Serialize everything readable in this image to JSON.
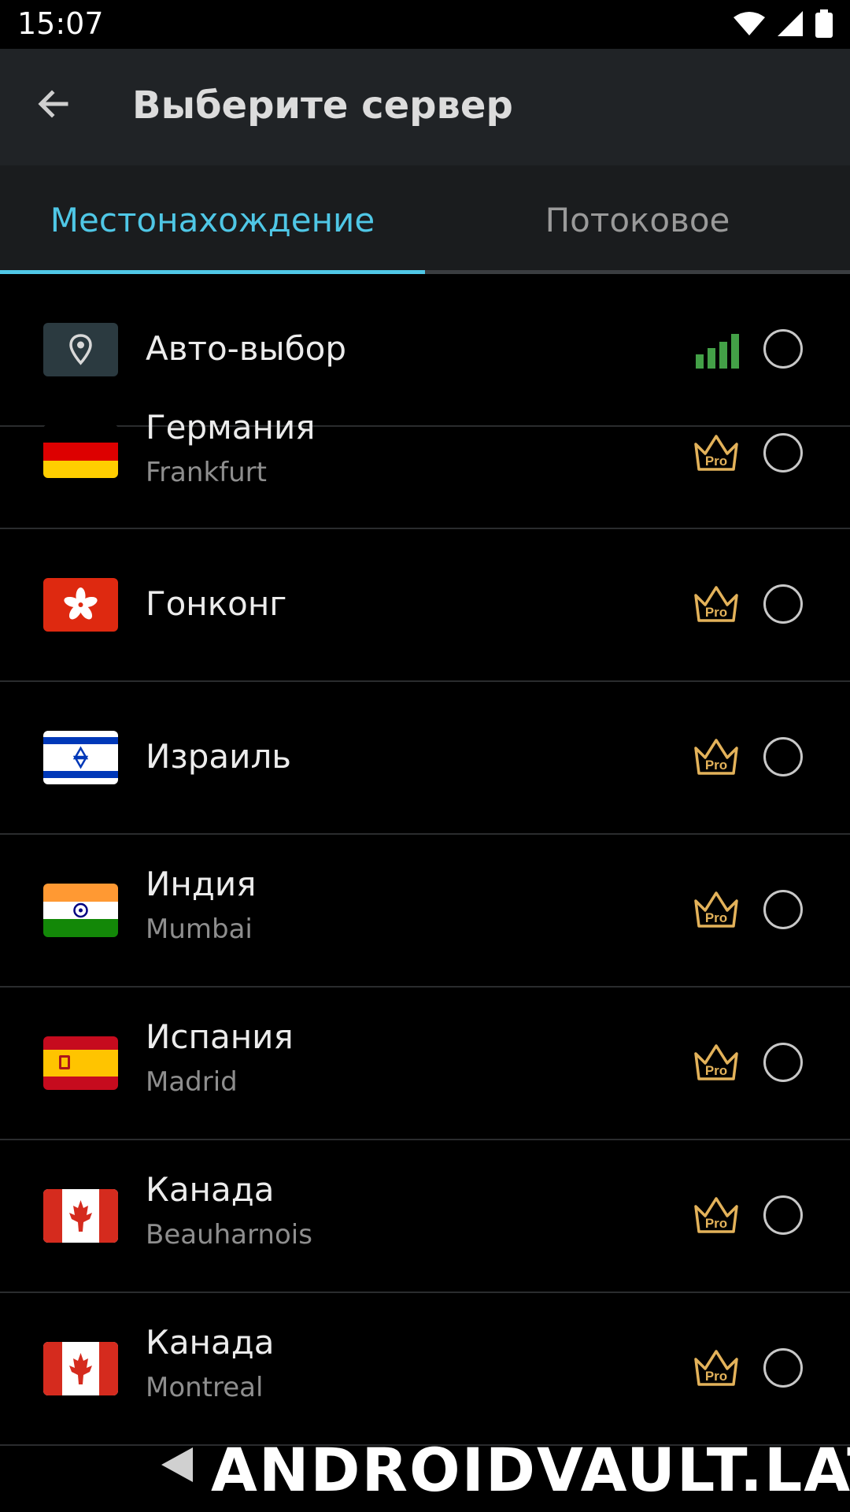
{
  "status_bar": {
    "time": "15:07"
  },
  "app_bar": {
    "title": "Выберите сервер"
  },
  "tabs": [
    {
      "label": "Местонахождение",
      "active": true
    },
    {
      "label": "Потоковое",
      "active": false
    }
  ],
  "colors": {
    "accent": "#4fc7e6",
    "pro_gold": "#e3b25a",
    "signal_green": "#43a047",
    "app_bar": "#202326"
  },
  "servers": [
    {
      "name": "Авто-выбор",
      "city": "",
      "icon": "location-pin-icon",
      "badge": "signal-strength-icon",
      "selected": false
    },
    {
      "name": "Германия",
      "city": "Frankfurt",
      "icon": "germany-flag-icon",
      "badge": "pro-crown-icon",
      "badge_text": "Pro",
      "selected": false
    },
    {
      "name": "Гонконг",
      "city": "",
      "icon": "hong-kong-flag-icon",
      "badge": "pro-crown-icon",
      "badge_text": "Pro",
      "selected": false
    },
    {
      "name": "Израиль",
      "city": "",
      "icon": "israel-flag-icon",
      "badge": "pro-crown-icon",
      "badge_text": "Pro",
      "selected": false
    },
    {
      "name": "Индия",
      "city": "Mumbai",
      "icon": "india-flag-icon",
      "badge": "pro-crown-icon",
      "badge_text": "Pro",
      "selected": false
    },
    {
      "name": "Испания",
      "city": "Madrid",
      "icon": "spain-flag-icon",
      "badge": "pro-crown-icon",
      "badge_text": "Pro",
      "selected": false
    },
    {
      "name": "Канада",
      "city": "Beauharnois",
      "icon": "canada-flag-icon",
      "badge": "pro-crown-icon",
      "badge_text": "Pro",
      "selected": false
    },
    {
      "name": "Канада",
      "city": "Montreal",
      "icon": "canada-flag-icon",
      "badge": "pro-crown-icon",
      "badge_text": "Pro",
      "selected": false
    }
  ],
  "watermark": "ANDROIDVAULT.LAT"
}
